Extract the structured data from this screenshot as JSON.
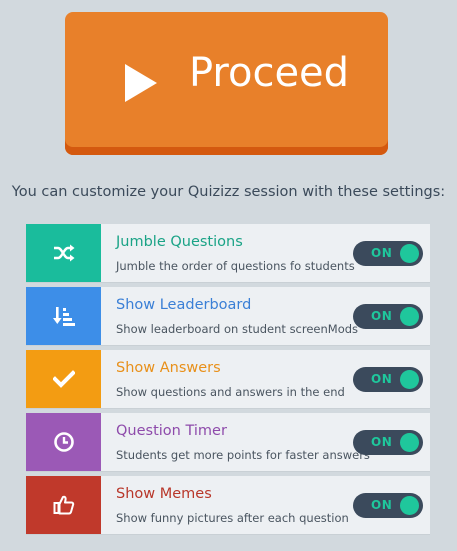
{
  "proceed": {
    "label": "Proceed",
    "icon": "play-icon"
  },
  "subtitle": "You can customize your Quizizz session with these settings:",
  "settings": [
    {
      "title": "Jumble Questions",
      "description": "Jumble the order of questions fo students",
      "toggle": "ON",
      "color": "#1abc9c",
      "title_color": "#1aa386",
      "icon": "shuffle-icon"
    },
    {
      "title": "Show Leaderboard",
      "description": "Show leaderboard on student screenMods",
      "toggle": "ON",
      "color": "#3d8ee8",
      "title_color": "#3a7fd6",
      "icon": "sort-descending-icon"
    },
    {
      "title": "Show Answers",
      "description": "Show questions and answers in the end",
      "toggle": "ON",
      "color": "#f39c12",
      "title_color": "#e8901a",
      "icon": "checkmark-icon"
    },
    {
      "title": "Question Timer",
      "description": "Students get more points for faster answers",
      "toggle": "ON",
      "color": "#9b59b6",
      "title_color": "#8e4bab",
      "icon": "clock-icon"
    },
    {
      "title": "Show Memes",
      "description": "Show funny pictures after each question",
      "toggle": "ON",
      "color": "#c0392b",
      "title_color": "#b8372a",
      "icon": "thumbs-up-icon"
    }
  ]
}
